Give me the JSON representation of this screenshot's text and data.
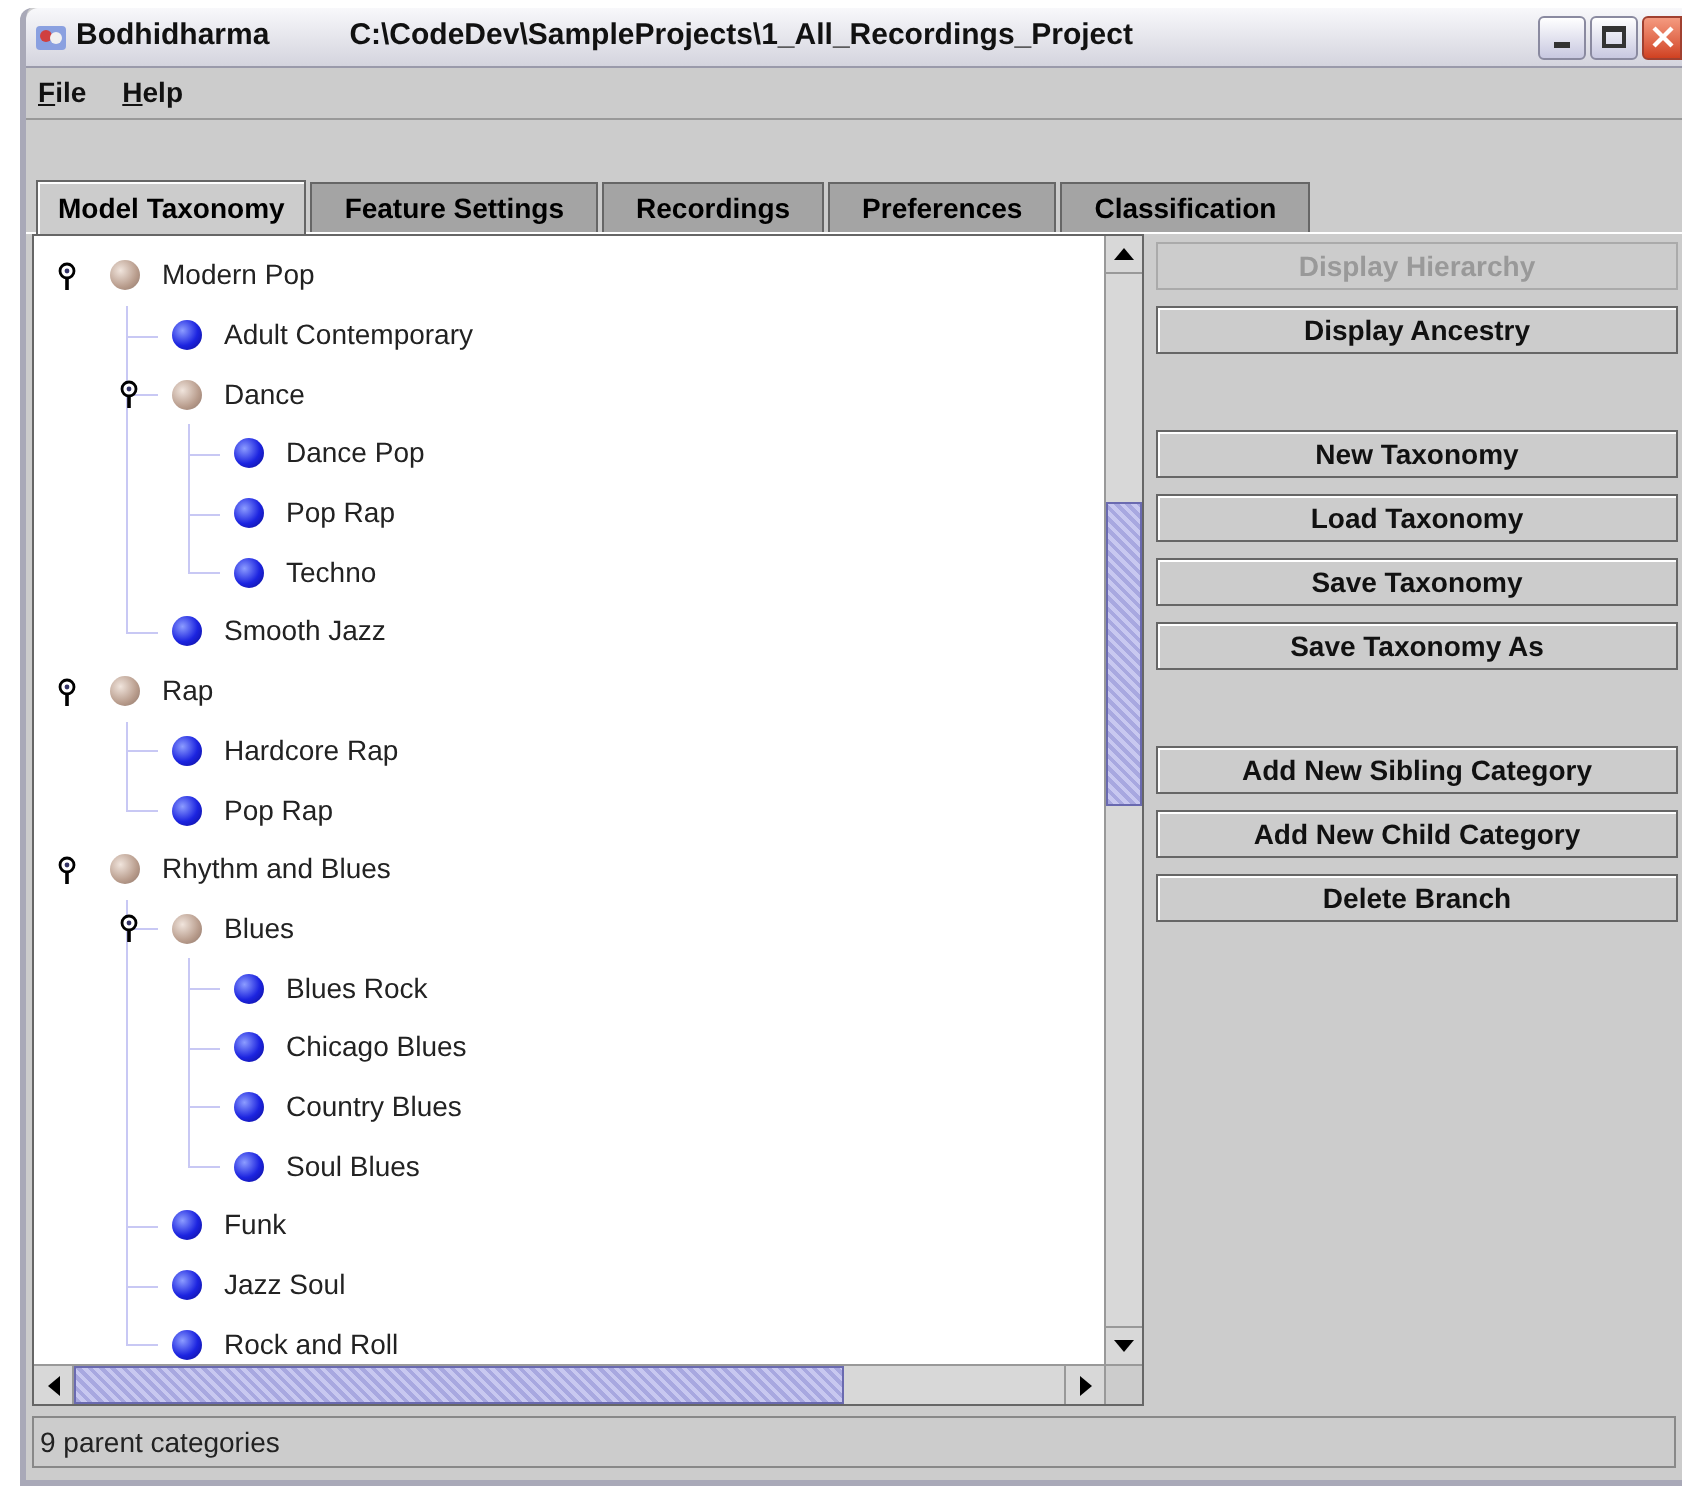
{
  "window": {
    "app_name": "Bodhidharma",
    "title": "C:\\CodeDev\\SampleProjects\\1_All_Recordings_Project"
  },
  "menu": [
    "File",
    "Help"
  ],
  "tabs": [
    {
      "label": "Model Taxonomy",
      "selected": true
    },
    {
      "label": "Feature Settings",
      "selected": false
    },
    {
      "label": "Recordings",
      "selected": false
    },
    {
      "label": "Preferences",
      "selected": false
    },
    {
      "label": "Classification",
      "selected": false
    }
  ],
  "tree": [
    {
      "label": "Modern Pop",
      "kind": "parent",
      "expanded": true,
      "children": [
        {
          "label": "Adult Contemporary",
          "kind": "leaf"
        },
        {
          "label": "Dance",
          "kind": "parent",
          "expanded": true,
          "children": [
            {
              "label": "Dance Pop",
              "kind": "leaf"
            },
            {
              "label": "Pop Rap",
              "kind": "leaf"
            },
            {
              "label": "Techno",
              "kind": "leaf"
            }
          ]
        },
        {
          "label": "Smooth Jazz",
          "kind": "leaf"
        }
      ]
    },
    {
      "label": "Rap",
      "kind": "parent",
      "expanded": true,
      "children": [
        {
          "label": "Hardcore Rap",
          "kind": "leaf"
        },
        {
          "label": "Pop Rap",
          "kind": "leaf"
        }
      ]
    },
    {
      "label": "Rhythm and Blues",
      "kind": "parent",
      "expanded": true,
      "children": [
        {
          "label": "Blues",
          "kind": "parent",
          "expanded": true,
          "children": [
            {
              "label": "Blues Rock",
              "kind": "leaf"
            },
            {
              "label": "Chicago Blues",
              "kind": "leaf"
            },
            {
              "label": "Country Blues",
              "kind": "leaf"
            },
            {
              "label": "Soul Blues",
              "kind": "leaf"
            }
          ]
        },
        {
          "label": "Funk",
          "kind": "leaf"
        },
        {
          "label": "Jazz Soul",
          "kind": "leaf"
        },
        {
          "label": "Rock and Roll",
          "kind": "leaf"
        }
      ]
    }
  ],
  "button_groups": [
    [
      {
        "label": "Display Hierarchy",
        "disabled": true
      },
      {
        "label": "Display Ancestry",
        "disabled": false
      }
    ],
    [
      {
        "label": "New Taxonomy",
        "disabled": false
      },
      {
        "label": "Load Taxonomy",
        "disabled": false
      },
      {
        "label": "Save Taxonomy",
        "disabled": false
      },
      {
        "label": "Save Taxonomy As",
        "disabled": false
      }
    ],
    [
      {
        "label": "Add New Sibling Category",
        "disabled": false
      },
      {
        "label": "Add New Child Category",
        "disabled": false
      },
      {
        "label": "Delete Branch",
        "disabled": false
      }
    ]
  ],
  "status_bar": "9 parent categories"
}
